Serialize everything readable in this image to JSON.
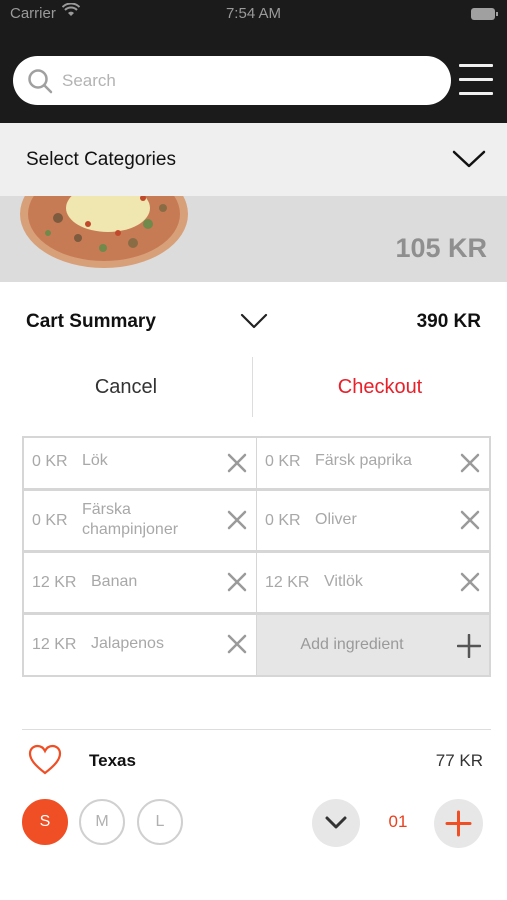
{
  "status_bar": {
    "carrier": "Carrier",
    "time": "7:54 AM"
  },
  "search": {
    "placeholder": "Search"
  },
  "categories": {
    "label": "Select Categories"
  },
  "hero": {
    "price": "105 KR"
  },
  "cart": {
    "title": "Cart Summary",
    "total": "390 KR",
    "cancel_label": "Cancel",
    "checkout_label": "Checkout"
  },
  "ingredients": [
    {
      "price": "0 KR",
      "name": "Lök"
    },
    {
      "price": "0 KR",
      "name": "Färsk paprika"
    },
    {
      "price": "0 KR",
      "name": "Färska champinjoner"
    },
    {
      "price": "0 KR",
      "name": "Oliver"
    },
    {
      "price": "12 KR",
      "name": "Banan"
    },
    {
      "price": "12 KR",
      "name": "Vitlök"
    },
    {
      "price": "12 KR",
      "name": "Jalapenos"
    }
  ],
  "add_ingredient_label": "Add ingredient",
  "item": {
    "name": "Texas",
    "price": "77 KR",
    "sizes": [
      "S",
      "M",
      "L"
    ],
    "selected_size": "S",
    "quantity": "01"
  },
  "colors": {
    "accent": "#f04e24",
    "checkout": "#e8202a",
    "header_bg": "#1b1b1c"
  }
}
